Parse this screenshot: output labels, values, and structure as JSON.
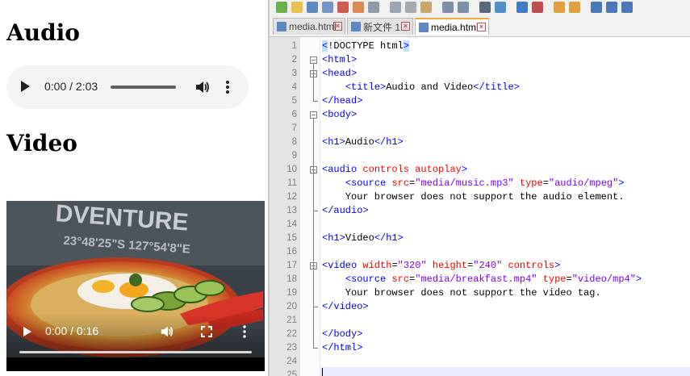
{
  "browser": {
    "audio_heading": "Audio",
    "video_heading": "Video",
    "audio_player": {
      "time": "0:00 / 2:03",
      "progress": 0
    },
    "video_player": {
      "time": "0:00 / 0:16",
      "progress": 0,
      "poster_text": "DVENTURE",
      "poster_text2": "23°48'25\"S  127°54'8\"E"
    }
  },
  "editor": {
    "tabs": [
      {
        "label": "media.html",
        "active": false
      },
      {
        "label": "新文件 1",
        "active": false
      },
      {
        "label": "media.html",
        "active": true
      }
    ],
    "lines": [
      {
        "n": "1",
        "text": "<!DOCTYPE html>"
      },
      {
        "n": "2",
        "text": "<html>"
      },
      {
        "n": "3",
        "text": "<head>"
      },
      {
        "n": "4",
        "text": "    <title>Audio and Video</title>"
      },
      {
        "n": "5",
        "text": "</head>"
      },
      {
        "n": "6",
        "text": "<body>"
      },
      {
        "n": "7",
        "text": ""
      },
      {
        "n": "8",
        "text": "<h1>Audio</h1>"
      },
      {
        "n": "9",
        "text": ""
      },
      {
        "n": "10",
        "text": "<audio controls autoplay>"
      },
      {
        "n": "11",
        "text": "    <source src=\"media/music.mp3\" type=\"audio/mpeg\">"
      },
      {
        "n": "12",
        "text": "    Your browser does not support the audio element."
      },
      {
        "n": "13",
        "text": "</audio>"
      },
      {
        "n": "14",
        "text": ""
      },
      {
        "n": "15",
        "text": "<h1>Video</h1>"
      },
      {
        "n": "16",
        "text": ""
      },
      {
        "n": "17",
        "text": "<video width=\"320\" height=\"240\" controls>"
      },
      {
        "n": "18",
        "text": "    <source src=\"media/breakfast.mp4\" type=\"video/mp4\">"
      },
      {
        "n": "19",
        "text": "    Your browser does not support the video tag."
      },
      {
        "n": "20",
        "text": "</video>"
      },
      {
        "n": "21",
        "text": ""
      },
      {
        "n": "22",
        "text": "</body>"
      },
      {
        "n": "23",
        "text": "</html>"
      },
      {
        "n": "24",
        "text": ""
      },
      {
        "n": "25",
        "text": ""
      }
    ],
    "colors": {
      "tag": "#0000ff",
      "attr": "#ff0000",
      "string": "#8000ff",
      "current_line": "#e8e8ff",
      "active_tab_accent": "#f7a83a"
    }
  }
}
